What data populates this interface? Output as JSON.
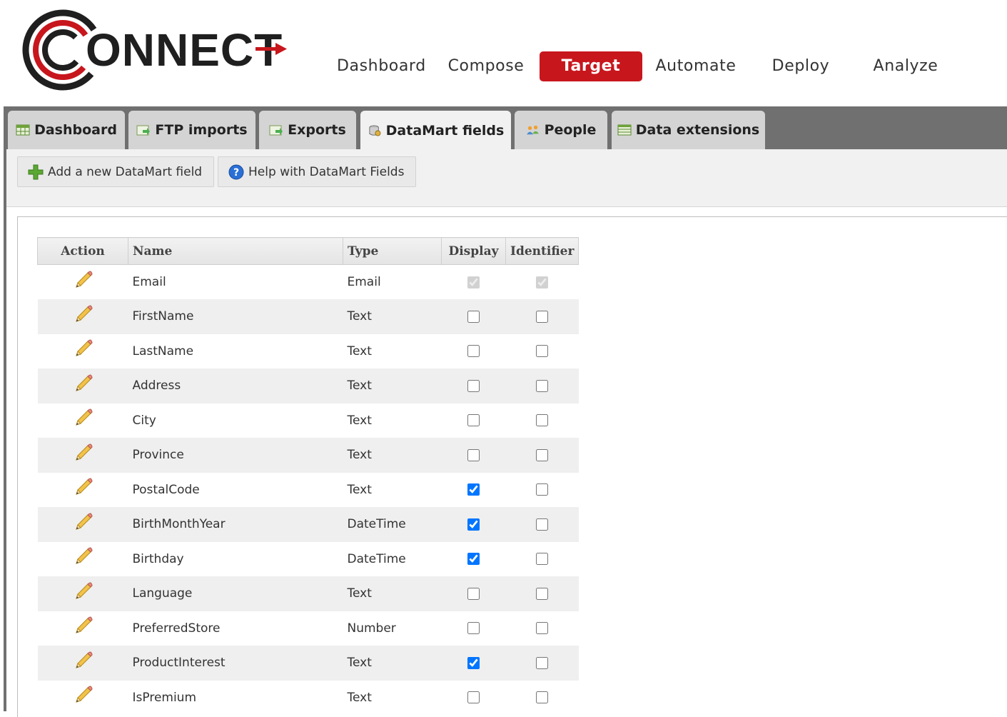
{
  "brand": {
    "logo_text": "CONNECT",
    "accent": "#c8161d"
  },
  "top_nav": [
    {
      "label": "Dashboard",
      "active": false
    },
    {
      "label": "Compose",
      "active": false
    },
    {
      "label": "Target",
      "active": true
    },
    {
      "label": "Automate",
      "active": false
    },
    {
      "label": "Deploy",
      "active": false
    },
    {
      "label": "Analyze",
      "active": false
    }
  ],
  "tabs": [
    {
      "label": "Dashboard",
      "icon": "calendar-grid-icon",
      "active": false
    },
    {
      "label": "FTP imports",
      "icon": "import-icon",
      "active": false
    },
    {
      "label": "Exports",
      "icon": "export-icon",
      "active": false
    },
    {
      "label": "DataMart fields",
      "icon": "database-icon",
      "active": true
    },
    {
      "label": "People",
      "icon": "people-icon",
      "active": false
    },
    {
      "label": "Data extensions",
      "icon": "table-icon",
      "active": false
    }
  ],
  "toolbar": {
    "add_label": "Add a new DataMart field",
    "help_label": "Help with DataMart Fields"
  },
  "table": {
    "headers": [
      "Action",
      "Name",
      "Type",
      "Display",
      "Identifier"
    ],
    "rows": [
      {
        "name": "Email",
        "type": "Email",
        "display": true,
        "identifier": true,
        "locked": true
      },
      {
        "name": "FirstName",
        "type": "Text",
        "display": false,
        "identifier": false,
        "locked": false
      },
      {
        "name": "LastName",
        "type": "Text",
        "display": false,
        "identifier": false,
        "locked": false
      },
      {
        "name": "Address",
        "type": "Text",
        "display": false,
        "identifier": false,
        "locked": false
      },
      {
        "name": "City",
        "type": "Text",
        "display": false,
        "identifier": false,
        "locked": false
      },
      {
        "name": "Province",
        "type": "Text",
        "display": false,
        "identifier": false,
        "locked": false
      },
      {
        "name": "PostalCode",
        "type": "Text",
        "display": true,
        "identifier": false,
        "locked": false
      },
      {
        "name": "BirthMonthYear",
        "type": "DateTime",
        "display": true,
        "identifier": false,
        "locked": false
      },
      {
        "name": "Birthday",
        "type": "DateTime",
        "display": true,
        "identifier": false,
        "locked": false
      },
      {
        "name": "Language",
        "type": "Text",
        "display": false,
        "identifier": false,
        "locked": false
      },
      {
        "name": "PreferredStore",
        "type": "Number",
        "display": false,
        "identifier": false,
        "locked": false
      },
      {
        "name": "ProductInterest",
        "type": "Text",
        "display": true,
        "identifier": false,
        "locked": false
      },
      {
        "name": "IsPremium",
        "type": "Text",
        "display": false,
        "identifier": false,
        "locked": false
      }
    ]
  }
}
